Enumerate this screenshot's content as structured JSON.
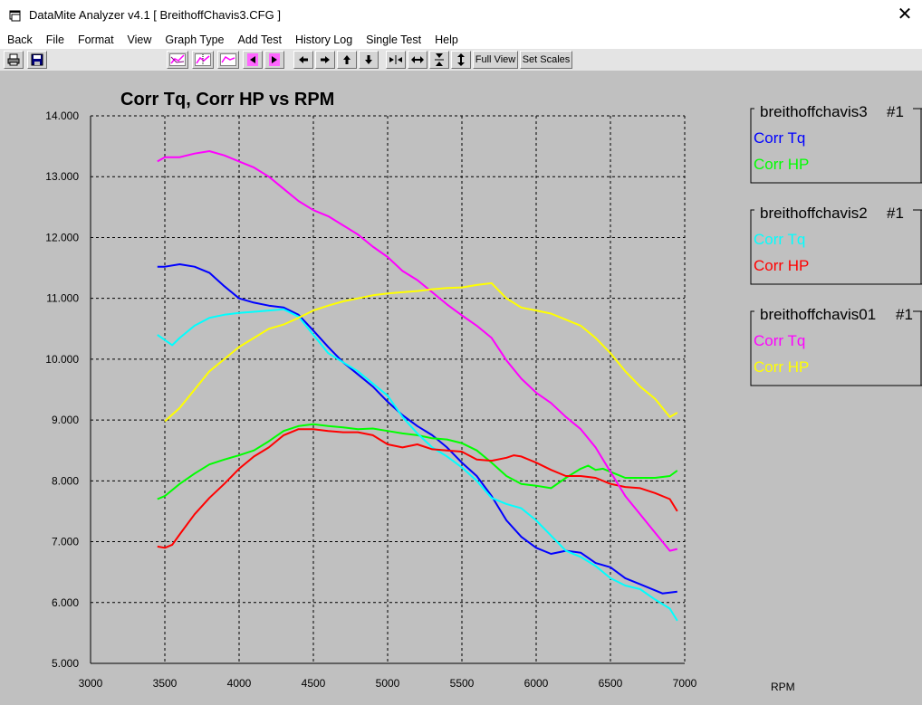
{
  "window": {
    "title": "DataMite Analyzer v4.1  [ BreithoffChavis3.CFG ]",
    "close_symbol": "✕"
  },
  "menu": [
    "Back",
    "File",
    "Format",
    "View",
    "Graph Type",
    "Add Test",
    "History Log",
    "Single Test",
    "Help"
  ],
  "toolbar": {
    "full_view": "Full View",
    "set_scales": "Set Scales",
    "icons": [
      "print-icon",
      "save-icon",
      "graph-type-1-icon",
      "graph-type-2-icon",
      "graph-type-3-icon",
      "step-left-icon",
      "step-right-icon",
      "arrow-left-icon",
      "arrow-right-icon",
      "arrow-up-icon",
      "arrow-down-icon",
      "zoom-in-horizontal-icon",
      "zoom-out-horizontal-icon",
      "zoom-in-vertical-icon",
      "zoom-out-vertical-icon"
    ]
  },
  "chart_data": {
    "type": "line",
    "title": "Corr Tq, Corr HP vs RPM",
    "xlabel": "RPM",
    "ylabel": "",
    "xlim": [
      3000,
      7000
    ],
    "ylim": [
      5.0,
      14.0
    ],
    "x_ticks": [
      "3000",
      "3500",
      "4000",
      "4500",
      "5000",
      "5500",
      "6000",
      "6500",
      "7000"
    ],
    "y_ticks": [
      "5.000",
      "6.000",
      "7.000",
      "8.000",
      "9.000",
      "10.000",
      "11.000",
      "12.000",
      "13.000",
      "14.000"
    ],
    "grid": true,
    "legend_groups": [
      {
        "test": "breithoffchavis3",
        "run": "#1",
        "entries": [
          {
            "label": "Corr Tq",
            "color": "#0000ff"
          },
          {
            "label": "Corr HP",
            "color": "#00ff00"
          }
        ]
      },
      {
        "test": "breithoffchavis2",
        "run": "#1",
        "entries": [
          {
            "label": "Corr Tq",
            "color": "#00ffff"
          },
          {
            "label": "Corr HP",
            "color": "#ff0000"
          }
        ]
      },
      {
        "test": "breithoffchavis01",
        "run": "#1",
        "entries": [
          {
            "label": "Corr Tq",
            "color": "#ff00ff"
          },
          {
            "label": "Corr HP",
            "color": "#ffff00"
          }
        ]
      }
    ],
    "series": [
      {
        "name": "breithoffchavis3 Corr Tq",
        "color": "#0000ff",
        "points": [
          [
            3450,
            11.52
          ],
          [
            3500,
            11.52
          ],
          [
            3600,
            11.56
          ],
          [
            3700,
            11.52
          ],
          [
            3800,
            11.42
          ],
          [
            3900,
            11.2
          ],
          [
            4000,
            11.0
          ],
          [
            4100,
            10.93
          ],
          [
            4200,
            10.88
          ],
          [
            4300,
            10.85
          ],
          [
            4400,
            10.73
          ],
          [
            4500,
            10.47
          ],
          [
            4600,
            10.2
          ],
          [
            4700,
            9.95
          ],
          [
            4800,
            9.75
          ],
          [
            4900,
            9.55
          ],
          [
            5000,
            9.3
          ],
          [
            5100,
            9.08
          ],
          [
            5200,
            8.9
          ],
          [
            5300,
            8.75
          ],
          [
            5400,
            8.55
          ],
          [
            5500,
            8.3
          ],
          [
            5600,
            8.08
          ],
          [
            5700,
            7.75
          ],
          [
            5800,
            7.35
          ],
          [
            5900,
            7.08
          ],
          [
            6000,
            6.9
          ],
          [
            6100,
            6.8
          ],
          [
            6200,
            6.85
          ],
          [
            6300,
            6.82
          ],
          [
            6400,
            6.65
          ],
          [
            6500,
            6.58
          ],
          [
            6600,
            6.4
          ],
          [
            6700,
            6.3
          ],
          [
            6800,
            6.2
          ],
          [
            6850,
            6.15
          ],
          [
            6950,
            6.18
          ]
        ]
      },
      {
        "name": "breithoffchavis3 Corr HP",
        "color": "#00ff00",
        "points": [
          [
            3450,
            7.7
          ],
          [
            3500,
            7.75
          ],
          [
            3600,
            7.95
          ],
          [
            3700,
            8.12
          ],
          [
            3800,
            8.27
          ],
          [
            3900,
            8.35
          ],
          [
            4000,
            8.42
          ],
          [
            4100,
            8.5
          ],
          [
            4200,
            8.65
          ],
          [
            4300,
            8.82
          ],
          [
            4400,
            8.9
          ],
          [
            4500,
            8.93
          ],
          [
            4600,
            8.9
          ],
          [
            4700,
            8.88
          ],
          [
            4800,
            8.85
          ],
          [
            4900,
            8.86
          ],
          [
            5000,
            8.82
          ],
          [
            5100,
            8.78
          ],
          [
            5200,
            8.75
          ],
          [
            5300,
            8.7
          ],
          [
            5400,
            8.68
          ],
          [
            5500,
            8.62
          ],
          [
            5600,
            8.5
          ],
          [
            5700,
            8.3
          ],
          [
            5800,
            8.08
          ],
          [
            5900,
            7.95
          ],
          [
            6000,
            7.92
          ],
          [
            6100,
            7.88
          ],
          [
            6200,
            8.05
          ],
          [
            6300,
            8.2
          ],
          [
            6350,
            8.25
          ],
          [
            6400,
            8.18
          ],
          [
            6450,
            8.2
          ],
          [
            6500,
            8.15
          ],
          [
            6600,
            8.05
          ],
          [
            6700,
            8.05
          ],
          [
            6800,
            8.05
          ],
          [
            6900,
            8.08
          ],
          [
            6950,
            8.17
          ]
        ]
      },
      {
        "name": "breithoffchavis2 Corr Tq",
        "color": "#00ffff",
        "points": [
          [
            3450,
            10.4
          ],
          [
            3550,
            10.23
          ],
          [
            3600,
            10.35
          ],
          [
            3700,
            10.55
          ],
          [
            3800,
            10.68
          ],
          [
            3900,
            10.73
          ],
          [
            4000,
            10.76
          ],
          [
            4100,
            10.78
          ],
          [
            4200,
            10.8
          ],
          [
            4300,
            10.82
          ],
          [
            4400,
            10.7
          ],
          [
            4500,
            10.4
          ],
          [
            4600,
            10.1
          ],
          [
            4700,
            9.95
          ],
          [
            4800,
            9.8
          ],
          [
            4900,
            9.6
          ],
          [
            5000,
            9.4
          ],
          [
            5100,
            9.05
          ],
          [
            5200,
            8.78
          ],
          [
            5300,
            8.55
          ],
          [
            5400,
            8.4
          ],
          [
            5500,
            8.22
          ],
          [
            5600,
            8.0
          ],
          [
            5700,
            7.72
          ],
          [
            5800,
            7.62
          ],
          [
            5900,
            7.55
          ],
          [
            6000,
            7.35
          ],
          [
            6100,
            7.1
          ],
          [
            6200,
            6.85
          ],
          [
            6300,
            6.75
          ],
          [
            6400,
            6.6
          ],
          [
            6500,
            6.4
          ],
          [
            6600,
            6.28
          ],
          [
            6700,
            6.22
          ],
          [
            6800,
            6.05
          ],
          [
            6900,
            5.9
          ],
          [
            6950,
            5.7
          ]
        ]
      },
      {
        "name": "breithoffchavis2 Corr HP",
        "color": "#ff0000",
        "points": [
          [
            3450,
            6.92
          ],
          [
            3500,
            6.9
          ],
          [
            3550,
            6.95
          ],
          [
            3600,
            7.12
          ],
          [
            3700,
            7.45
          ],
          [
            3800,
            7.72
          ],
          [
            3900,
            7.95
          ],
          [
            4000,
            8.2
          ],
          [
            4100,
            8.4
          ],
          [
            4200,
            8.55
          ],
          [
            4300,
            8.75
          ],
          [
            4400,
            8.85
          ],
          [
            4500,
            8.85
          ],
          [
            4600,
            8.82
          ],
          [
            4700,
            8.8
          ],
          [
            4800,
            8.8
          ],
          [
            4900,
            8.75
          ],
          [
            5000,
            8.6
          ],
          [
            5100,
            8.55
          ],
          [
            5200,
            8.6
          ],
          [
            5300,
            8.52
          ],
          [
            5400,
            8.5
          ],
          [
            5500,
            8.48
          ],
          [
            5600,
            8.35
          ],
          [
            5700,
            8.33
          ],
          [
            5800,
            8.38
          ],
          [
            5850,
            8.42
          ],
          [
            5900,
            8.4
          ],
          [
            6000,
            8.3
          ],
          [
            6100,
            8.18
          ],
          [
            6200,
            8.08
          ],
          [
            6300,
            8.08
          ],
          [
            6400,
            8.05
          ],
          [
            6500,
            7.95
          ],
          [
            6600,
            7.9
          ],
          [
            6700,
            7.88
          ],
          [
            6800,
            7.8
          ],
          [
            6900,
            7.7
          ],
          [
            6950,
            7.5
          ]
        ]
      },
      {
        "name": "breithoffchavis01 Corr Tq",
        "color": "#ff00ff",
        "points": [
          [
            3450,
            13.25
          ],
          [
            3500,
            13.32
          ],
          [
            3600,
            13.32
          ],
          [
            3700,
            13.38
          ],
          [
            3800,
            13.42
          ],
          [
            3900,
            13.35
          ],
          [
            4000,
            13.25
          ],
          [
            4100,
            13.15
          ],
          [
            4200,
            13.0
          ],
          [
            4300,
            12.8
          ],
          [
            4400,
            12.6
          ],
          [
            4500,
            12.45
          ],
          [
            4600,
            12.35
          ],
          [
            4700,
            12.2
          ],
          [
            4800,
            12.05
          ],
          [
            4900,
            11.85
          ],
          [
            5000,
            11.68
          ],
          [
            5100,
            11.45
          ],
          [
            5200,
            11.3
          ],
          [
            5300,
            11.1
          ],
          [
            5400,
            10.9
          ],
          [
            5500,
            10.72
          ],
          [
            5600,
            10.55
          ],
          [
            5700,
            10.35
          ],
          [
            5800,
            9.98
          ],
          [
            5900,
            9.68
          ],
          [
            6000,
            9.45
          ],
          [
            6100,
            9.28
          ],
          [
            6200,
            9.05
          ],
          [
            6300,
            8.85
          ],
          [
            6400,
            8.55
          ],
          [
            6500,
            8.15
          ],
          [
            6600,
            7.75
          ],
          [
            6700,
            7.45
          ],
          [
            6800,
            7.15
          ],
          [
            6900,
            6.85
          ],
          [
            6950,
            6.88
          ]
        ]
      },
      {
        "name": "breithoffchavis01 Corr HP",
        "color": "#ffff00",
        "points": [
          [
            3500,
            8.98
          ],
          [
            3600,
            9.2
          ],
          [
            3700,
            9.5
          ],
          [
            3800,
            9.8
          ],
          [
            3900,
            10.0
          ],
          [
            4000,
            10.2
          ],
          [
            4100,
            10.35
          ],
          [
            4200,
            10.5
          ],
          [
            4300,
            10.57
          ],
          [
            4400,
            10.68
          ],
          [
            4500,
            10.8
          ],
          [
            4600,
            10.88
          ],
          [
            4700,
            10.95
          ],
          [
            4800,
            11.0
          ],
          [
            4900,
            11.05
          ],
          [
            5000,
            11.08
          ],
          [
            5100,
            11.1
          ],
          [
            5200,
            11.12
          ],
          [
            5300,
            11.15
          ],
          [
            5400,
            11.17
          ],
          [
            5500,
            11.18
          ],
          [
            5600,
            11.22
          ],
          [
            5700,
            11.25
          ],
          [
            5800,
            11.0
          ],
          [
            5900,
            10.85
          ],
          [
            6000,
            10.8
          ],
          [
            6100,
            10.75
          ],
          [
            6200,
            10.65
          ],
          [
            6300,
            10.55
          ],
          [
            6400,
            10.35
          ],
          [
            6500,
            10.1
          ],
          [
            6600,
            9.8
          ],
          [
            6700,
            9.55
          ],
          [
            6800,
            9.35
          ],
          [
            6900,
            9.05
          ],
          [
            6950,
            9.12
          ]
        ]
      }
    ]
  }
}
